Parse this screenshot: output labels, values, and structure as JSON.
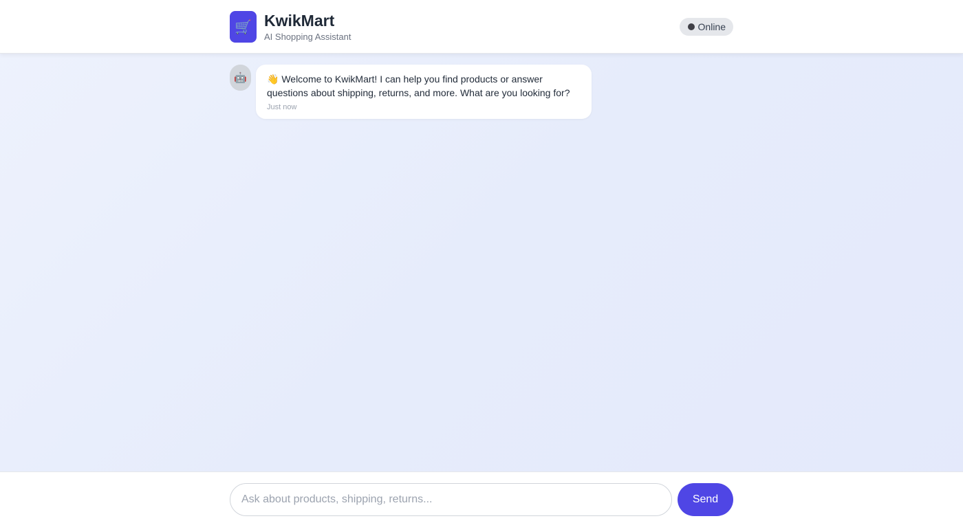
{
  "header": {
    "logo_icon": "shopping-cart-icon",
    "logo_glyph": "🛒",
    "title": "KwikMart",
    "subtitle": "AI Shopping Assistant",
    "status_label": "Online"
  },
  "messages": [
    {
      "sender": "bot",
      "avatar_icon": "robot-icon",
      "avatar_glyph": "🤖",
      "text": "👋 Welcome to KwikMart! I can help you find products or answer questions about shipping, returns, and more. What are you looking for?",
      "time": "Just now"
    }
  ],
  "composer": {
    "placeholder": "Ask about products, shipping, returns...",
    "value": "",
    "send_label": "Send"
  },
  "colors": {
    "accent": "#4f46e5",
    "status_pill_bg": "#e5e7eb",
    "background": "#e8edfb"
  }
}
